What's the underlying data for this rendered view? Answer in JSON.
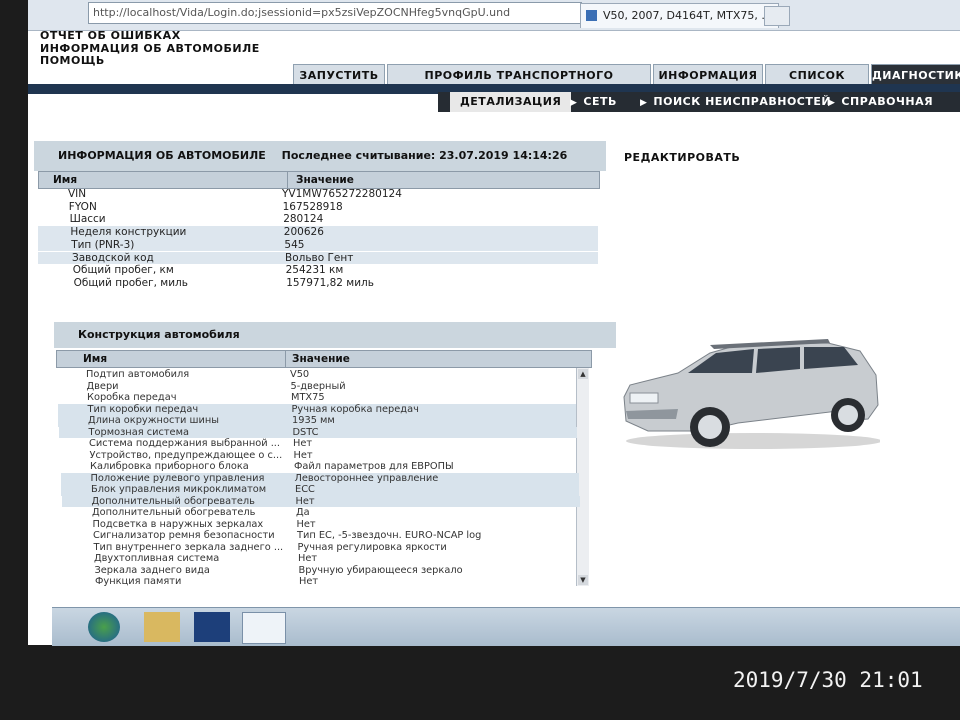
{
  "browser": {
    "url": "http://localhost/Vida/Login.do;jsessionid=px5zsiVepZOCNHfeg5vnqGpU.und",
    "tab_title": "V50, 2007, D4164T, MTX75, ..."
  },
  "top_menu": [
    "ОТЧЕТ ОБ ОШИБКАХ",
    "ИНФОРМАЦИЯ ОБ АВТОМОБИЛЕ",
    "ПОМОЩЬ"
  ],
  "nav_tabs": [
    "ЗАПУСТИТЬ",
    "ПРОФИЛЬ ТРАНСПОРТНОГО СРЕДСТВА",
    "ИНФОРМАЦИЯ",
    "СПИСОК РАБОТ",
    "ДИАГНОСТИКА"
  ],
  "sub_tabs": [
    "ДЕТАЛИЗАЦИЯ",
    "СЕТЬ",
    "ПОИСК НЕИСПРАВНОСТЕЙ",
    "СПРАВОЧНАЯ ИНФОРМ"
  ],
  "vehicle_info": {
    "title": "ИНФОРМАЦИЯ ОБ АВТОМОБИЛЕ",
    "last_read": "Последнее считывание: 23.07.2019 14:14:26",
    "col_name": "Имя",
    "col_value": "Значение",
    "rows": [
      {
        "name": "VIN",
        "value": "YV1MW765272280124"
      },
      {
        "name": "FYON",
        "value": "167528918"
      },
      {
        "name": "Шасси",
        "value": "280124"
      },
      {
        "name": "Неделя конструкции",
        "value": "200626"
      },
      {
        "name": "Тип (PNR-3)",
        "value": "545"
      },
      {
        "name": "Заводской код",
        "value": "Вольво Гент"
      },
      {
        "name": "Общий пробег, км",
        "value": "254231 км"
      },
      {
        "name": "Общий пробег, миль",
        "value": "157971,82 миль"
      }
    ]
  },
  "edit_label": "РЕДАКТИРОВАТЬ",
  "construction": {
    "title": "Конструкция автомобиля",
    "col_name": "Имя",
    "col_value": "Значение",
    "rows": [
      {
        "name": "Подтип автомобиля",
        "value": "V50"
      },
      {
        "name": "Двери",
        "value": "5-дверный"
      },
      {
        "name": "Коробка передач",
        "value": "MTX75"
      },
      {
        "name": "Тип коробки передач",
        "value": "Ручная коробка передач"
      },
      {
        "name": "Длина окружности шины",
        "value": "1935 мм"
      },
      {
        "name": "Тормозная система",
        "value": "DSTC"
      },
      {
        "name": "Система поддержания выбранной ...",
        "value": "Нет"
      },
      {
        "name": "Устройство, предупреждающее о с...",
        "value": "Нет"
      },
      {
        "name": "Калибровка приборного блока",
        "value": "Файл параметров для ЕВРОПЫ"
      },
      {
        "name": "Положение рулевого управления",
        "value": "Левостороннее управление"
      },
      {
        "name": "Блок управления микроклиматом",
        "value": "ECC"
      },
      {
        "name": "Дополнительный обогреватель",
        "value": "Нет"
      },
      {
        "name": "Дополнительный обогреватель",
        "value": "Да"
      },
      {
        "name": "Подсветка в наружных зеркалах",
        "value": "Нет"
      },
      {
        "name": "Сигнализатор ремня безопасности",
        "value": "Тип ЕС, -5-звездочн. EURO-NCAP log"
      },
      {
        "name": "Тип внутреннего зеркала заднего ...",
        "value": "Ручная регулировка яркости"
      },
      {
        "name": "Двухтопливная система",
        "value": "Нет"
      },
      {
        "name": "Зеркала заднего вида",
        "value": "Вручную убирающееся зеркало"
      },
      {
        "name": "Функция памяти",
        "value": "Нет"
      }
    ]
  },
  "photo_timestamp": "2019/7/30  21:01",
  "colors": {
    "nav_dark": "#1f3550",
    "row_alt": "#dde6ee"
  }
}
